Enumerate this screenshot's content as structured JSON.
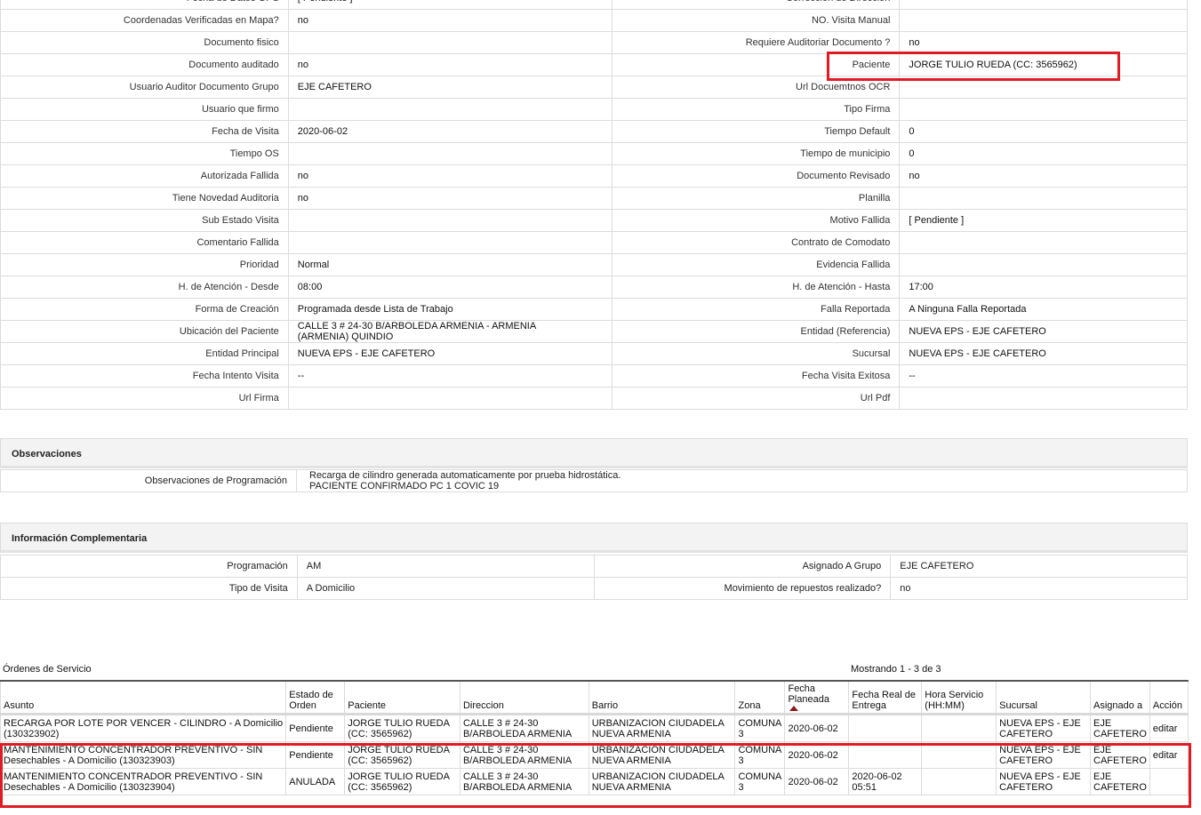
{
  "detail_rows": [
    {
      "l1": "Fecha de Datos GPS",
      "v1": "[ Pendiente ]",
      "l2": "Corrección de Dirección",
      "v2": ""
    },
    {
      "l1": "Coordenadas Verificadas en Mapa?",
      "v1": "no",
      "l2": "NO. Visita Manual",
      "v2": ""
    },
    {
      "l1": "Documento fisico",
      "v1": "",
      "l2": "Requiere Auditoriar Documento ?",
      "v2": "no"
    },
    {
      "l1": "Documento auditado",
      "v1": "no",
      "l2": "Paciente",
      "v2": "JORGE TULIO RUEDA (CC: 3565962)"
    },
    {
      "l1": "Usuario Auditor Documento Grupo",
      "v1": "EJE CAFETERO",
      "l2": "Url Docuemtnos OCR",
      "v2": ""
    },
    {
      "l1": "Usuario que firmo",
      "v1": "",
      "l2": "Tipo Firma",
      "v2": ""
    },
    {
      "l1": "Fecha de Visita",
      "v1": "2020-06-02",
      "l2": "Tiempo Default",
      "v2": "0"
    },
    {
      "l1": "Tiempo OS",
      "v1": "",
      "l2": "Tiempo de municipio",
      "v2": "0"
    },
    {
      "l1": "Autorizada Fallida",
      "v1": "no",
      "l2": "Documento Revisado",
      "v2": "no"
    },
    {
      "l1": "Tiene Novedad Auditoria",
      "v1": "no",
      "l2": "Planilla",
      "v2": ""
    },
    {
      "l1": "Sub Estado Visita",
      "v1": "",
      "l2": "Motivo Fallida",
      "v2": "[ Pendiente ]"
    },
    {
      "l1": "Comentario Fallida",
      "v1": "",
      "l2": "Contrato de Comodato",
      "v2": ""
    },
    {
      "l1": "Prioridad",
      "v1": "Normal",
      "l2": "Evidencia Fallida",
      "v2": ""
    },
    {
      "l1": "H. de Atención - Desde",
      "v1": "08:00",
      "l2": "H. de Atención - Hasta",
      "v2": "17:00"
    },
    {
      "l1": "Forma de Creación",
      "v1": "Programada desde Lista de Trabajo",
      "l2": "Falla Reportada",
      "v2": "A Ninguna Falla Reportada"
    },
    {
      "l1": "Ubicación del Paciente",
      "v1": "CALLE 3 # 24-30 B/ARBOLEDA ARMENIA - ARMENIA (ARMENIA) QUINDIO",
      "l2": "Entidad (Referencia)",
      "v2": "NUEVA EPS - EJE CAFETERO"
    },
    {
      "l1": "Entidad Principal",
      "v1": "NUEVA EPS - EJE CAFETERO",
      "l2": "Sucursal",
      "v2": "NUEVA EPS - EJE CAFETERO"
    },
    {
      "l1": "Fecha Intento Visita",
      "v1": "--",
      "l2": "Fecha Visita Exitosa",
      "v2": "--"
    },
    {
      "l1": "Url Firma",
      "v1": "",
      "l2": "Url Pdf",
      "v2": ""
    }
  ],
  "observaciones": {
    "title": "Observaciones",
    "label": "Observaciones de Programación",
    "line1": "Recarga de cilindro generada automaticamente por prueba hidrostática.",
    "line2": "PACIENTE CONFIRMADO PC 1 COVIC 19"
  },
  "info_comp": {
    "title": "Información Complementaria",
    "rows": [
      {
        "l1": "Programación",
        "v1": "AM",
        "l2": "Asignado A Grupo",
        "v2": "EJE CAFETERO"
      },
      {
        "l1": "Tipo de Visita",
        "v1": "A Domicilio",
        "l2": "Movimiento de repuestos realizado?",
        "v2": "no"
      }
    ]
  },
  "orders": {
    "title": "Órdenes de Servicio",
    "count": "Mostrando 1 - 3 de 3",
    "headers": [
      "Asunto",
      "Estado de Orden",
      "Paciente",
      "Direccion",
      "Barrio",
      "Zona",
      "Fecha Planeada",
      "Fecha Real de Entrega",
      "Hora Servicio (HH:MM)",
      "Sucursal",
      "Asignado a",
      "Acción"
    ],
    "rows": [
      {
        "asunto": "RECARGA POR LOTE POR VENCER - CILINDRO - A Domicilio (130323902)",
        "estado": "Pendiente",
        "paciente": "JORGE TULIO RUEDA (CC: 3565962)",
        "direccion": "CALLE 3 # 24-30 B/ARBOLEDA ARMENIA",
        "barrio": "URBANIZACION CIUDADELA NUEVA ARMENIA",
        "zona": "COMUNA 3",
        "fecha_planeada": "2020-06-02",
        "fecha_real": "",
        "hora": "",
        "sucursal": "NUEVA EPS - EJE CAFETERO",
        "asignado": "EJE CAFETERO",
        "accion": "editar"
      },
      {
        "asunto": "MANTENIMIENTO CONCENTRADOR PREVENTIVO - SIN Desechables - A Domicilio (130323903)",
        "estado": "Pendiente",
        "paciente": "JORGE TULIO RUEDA (CC: 3565962)",
        "direccion": "CALLE 3 # 24-30 B/ARBOLEDA ARMENIA",
        "barrio": "URBANIZACION CIUDADELA NUEVA ARMENIA",
        "zona": "COMUNA 3",
        "fecha_planeada": "2020-06-02",
        "fecha_real": "",
        "hora": "",
        "sucursal": "NUEVA EPS - EJE CAFETERO",
        "asignado": "EJE CAFETERO",
        "accion": "editar"
      },
      {
        "asunto": "MANTENIMIENTO CONCENTRADOR PREVENTIVO - SIN Desechables - A Domicilio (130323904)",
        "estado": "ANULADA",
        "paciente": "JORGE TULIO RUEDA (CC: 3565962)",
        "direccion": "CALLE 3 # 24-30 B/ARBOLEDA ARMENIA",
        "barrio": "URBANIZACION CIUDADELA NUEVA ARMENIA",
        "zona": "COMUNA 3",
        "fecha_planeada": "2020-06-02",
        "fecha_real": "2020-06-02 05:51",
        "hora": "",
        "sucursal": "NUEVA EPS - EJE CAFETERO",
        "asignado": "EJE CAFETERO",
        "accion": ""
      }
    ]
  },
  "colors": {
    "highlight": "#e01b24",
    "sort_arrow": "#8b1c1c",
    "border": "#dcdcdc"
  },
  "icons": {
    "sort": "sort-asc-icon"
  }
}
